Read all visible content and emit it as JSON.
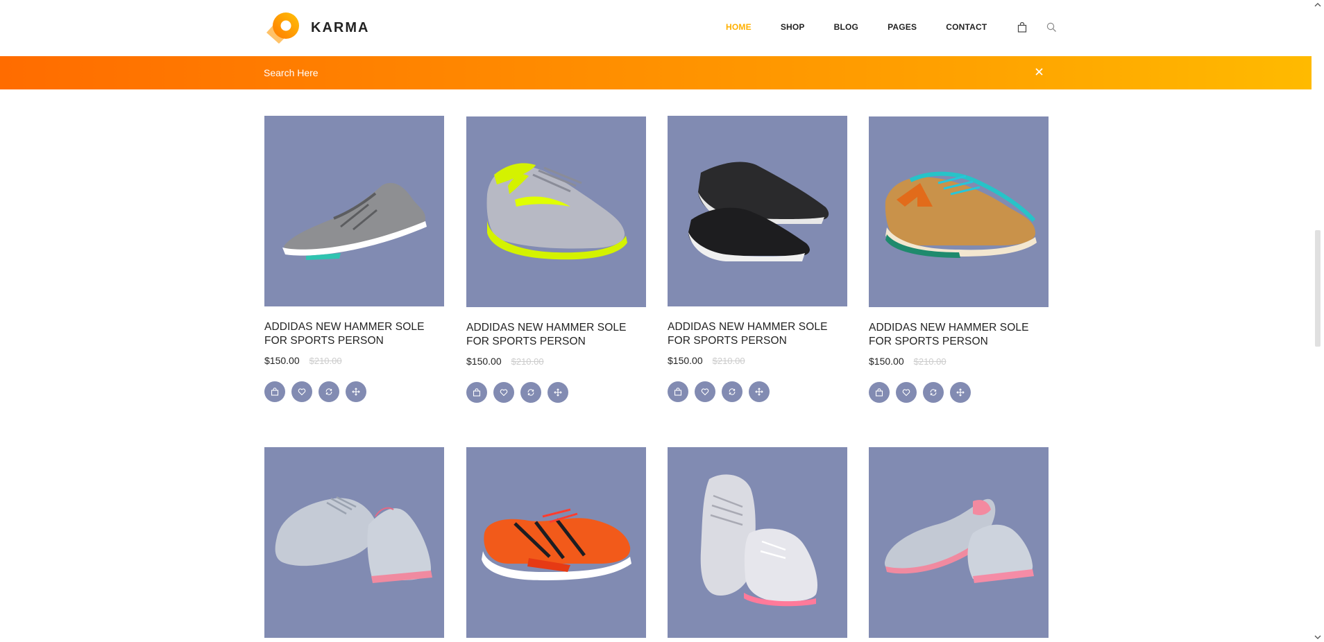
{
  "brand": {
    "name": "KARMA"
  },
  "nav": {
    "items": [
      {
        "label": "HOME",
        "active": true
      },
      {
        "label": "SHOP",
        "active": false
      },
      {
        "label": "BLOG",
        "active": false
      },
      {
        "label": "PAGES",
        "active": false
      },
      {
        "label": "CONTACT",
        "active": false
      }
    ],
    "icons": [
      "shopping-bag-icon",
      "search-icon"
    ]
  },
  "search": {
    "placeholder": "Search Here",
    "value": ""
  },
  "colors": {
    "accent": "#ffb000",
    "banner_start": "#ff6c00",
    "banner_end": "#ffba00",
    "card_bg": "#818bb2",
    "action_bg": "#828bb2"
  },
  "products": [
    {
      "title": "ADDIDAS NEW HAMMER SOLE FOR SPORTS PERSON",
      "price": "$150.00",
      "old_price": "$210.00",
      "image": "grey-running-shoe"
    },
    {
      "title": "ADDIDAS NEW HAMMER SOLE FOR SPORTS PERSON",
      "price": "$150.00",
      "old_price": "$210.00",
      "image": "neon-green-running-shoe"
    },
    {
      "title": "ADDIDAS NEW HAMMER SOLE FOR SPORTS PERSON",
      "price": "$150.00",
      "old_price": "$210.00",
      "image": "black-slip-on-pair"
    },
    {
      "title": "ADDIDAS NEW HAMMER SOLE FOR SPORTS PERSON",
      "price": "$150.00",
      "old_price": "$210.00",
      "image": "tan-retro-sneaker-pair"
    },
    {
      "title": "",
      "price": "",
      "old_price": "",
      "image": "grey-sneaker-pair"
    },
    {
      "title": "",
      "price": "",
      "old_price": "",
      "image": "orange-running-shoe"
    },
    {
      "title": "",
      "price": "",
      "old_price": "",
      "image": "worn-white-sneaker-pair"
    },
    {
      "title": "",
      "price": "",
      "old_price": "",
      "image": "grey-pink-sneaker-pair"
    }
  ],
  "product_actions": [
    "add-to-bag-icon",
    "heart-icon",
    "refresh-icon",
    "move-icon"
  ]
}
